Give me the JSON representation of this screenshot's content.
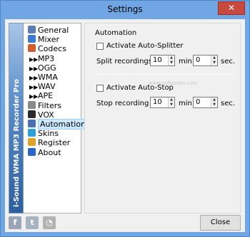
{
  "window": {
    "title": "Settings",
    "close_glyph": "✕"
  },
  "brand": {
    "text": "i-Sound WMA MP3 Recorder Pro"
  },
  "tree": [
    {
      "label": "General",
      "icon": "gear-icon",
      "color": "#5b7fb5"
    },
    {
      "label": "Mixer",
      "icon": "mixer-icon",
      "color": "#3c7bd1"
    },
    {
      "label": "Codecs",
      "icon": "wrench-icon",
      "color": "#d35c2f"
    },
    {
      "label": "MP3",
      "sub": true
    },
    {
      "label": "OGG",
      "sub": true
    },
    {
      "label": "WMA",
      "sub": true
    },
    {
      "label": "WAV",
      "sub": true
    },
    {
      "label": "APE",
      "sub": true
    },
    {
      "label": "Filters",
      "icon": "filter-icon",
      "color": "#8a8a8a"
    },
    {
      "label": "VOX",
      "icon": "vox-icon",
      "color": "#2a2a2a"
    },
    {
      "label": "Automation",
      "icon": "automation-icon",
      "color": "#4a6fb4",
      "selected": true
    },
    {
      "label": "Skins",
      "icon": "skins-icon",
      "color": "#2f9fd8"
    },
    {
      "label": "Register",
      "icon": "lock-icon",
      "color": "#e0a12a"
    },
    {
      "label": "About",
      "icon": "info-icon",
      "color": "#2a66c9"
    }
  ],
  "automation": {
    "group_title": "Automation",
    "auto_splitter": {
      "label": "Activate Auto-Splitter",
      "checked": false
    },
    "split_label": "Split recordings by :",
    "split_value": "10",
    "min_unit": "min.",
    "split_sec_value": "0",
    "sec_unit": "sec.",
    "auto_stop": {
      "label": "Activate Auto-Stop",
      "checked": false
    },
    "stop_label": "Stop recording after :",
    "stop_value": "10",
    "stop_min_unit": "min.",
    "stop_sec_value": "0",
    "stop_sec_unit": "sec."
  },
  "footer": {
    "facebook": "f",
    "twitter": "t",
    "rss": "◔",
    "close_label": "Close"
  }
}
